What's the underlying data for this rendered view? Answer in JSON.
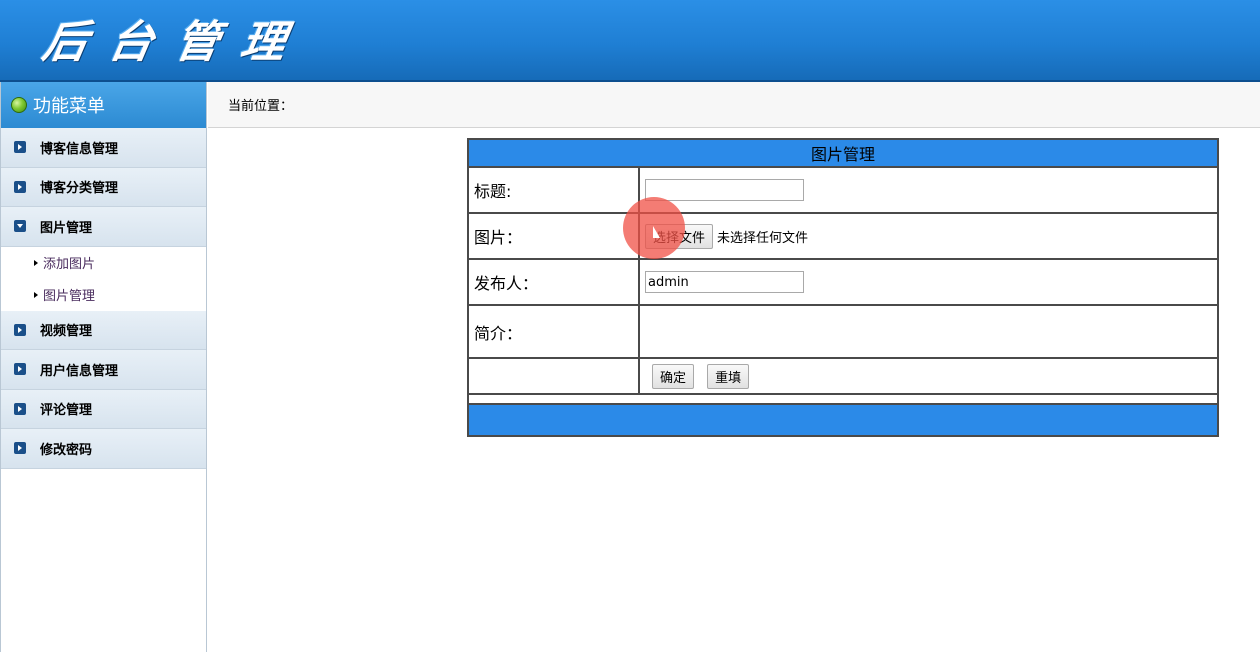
{
  "header": {
    "logo_text": "后台管理"
  },
  "sidebar": {
    "menu_title": "功能菜单",
    "items": [
      {
        "label": "博客信息管理",
        "open": false
      },
      {
        "label": "博客分类管理",
        "open": false
      },
      {
        "label": "图片管理",
        "open": true,
        "children": [
          "添加图片",
          "图片管理"
        ]
      },
      {
        "label": "视频管理",
        "open": false
      },
      {
        "label": "用户信息管理",
        "open": false
      },
      {
        "label": "评论管理",
        "open": false
      },
      {
        "label": "修改密码",
        "open": false
      }
    ]
  },
  "breadcrumb": {
    "label": "当前位置："
  },
  "form": {
    "caption": "图片管理",
    "title_label": "标题:",
    "title_value": "",
    "image_label": "图片：",
    "file_button": "选择文件",
    "file_status": "未选择任何文件",
    "publisher_label": "发布人：",
    "publisher_value": "admin",
    "intro_label": "简介：",
    "submit_label": "确定",
    "reset_label": "重填"
  },
  "colors": {
    "header": "#1f7fd4",
    "table_caption": "#2b8ae8",
    "menu_head": "#2c8ad2",
    "click_indicator": "#f05046"
  }
}
